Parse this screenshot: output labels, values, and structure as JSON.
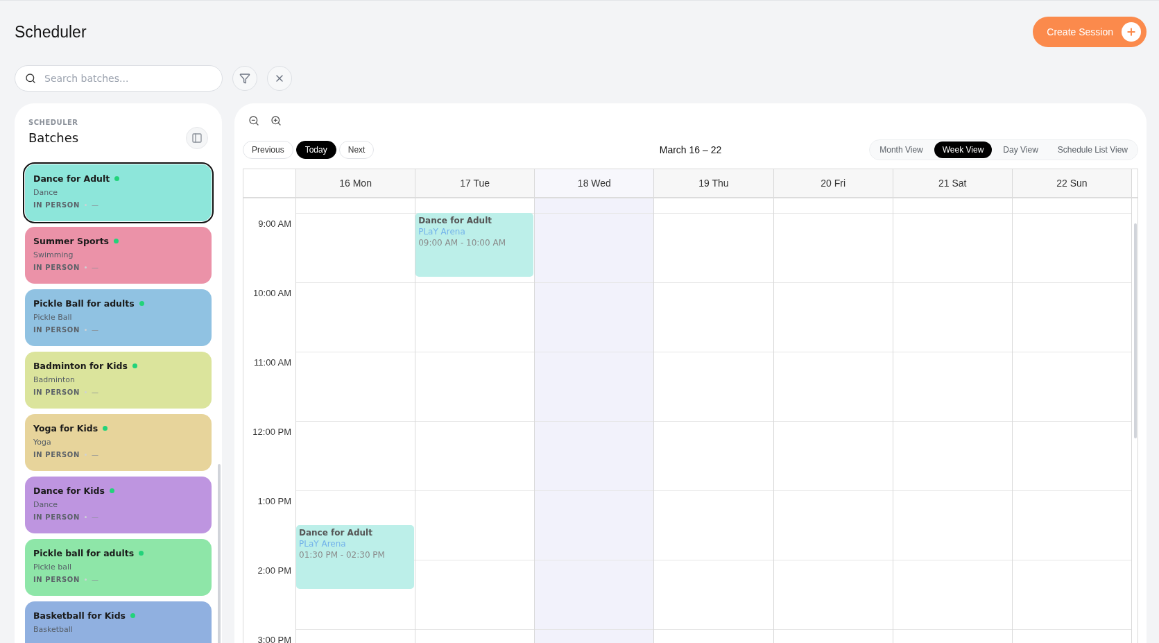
{
  "page": {
    "title": "Scheduler",
    "create_button": "Create Session"
  },
  "search": {
    "placeholder": "Search batches..."
  },
  "sidebar": {
    "eyebrow": "SCHEDULER",
    "title": "Batches",
    "batches": [
      {
        "name": "Dance for Adult",
        "sport": "Dance",
        "mode": "IN PERSON",
        "trainer": "—",
        "color": "#8de6da",
        "selected": true
      },
      {
        "name": "Summer Sports",
        "sport": "Swimming",
        "mode": "IN PERSON",
        "trainer": "—",
        "color": "#eb92a8",
        "selected": false
      },
      {
        "name": "Pickle Ball for adults",
        "sport": "Pickle Ball",
        "mode": "IN PERSON",
        "trainer": "—",
        "color": "#90c2e2",
        "selected": false
      },
      {
        "name": "Badminton for Kids",
        "sport": "Badminton",
        "mode": "IN PERSON",
        "trainer": "—",
        "color": "#dbe49c",
        "selected": false
      },
      {
        "name": "Yoga for Kids",
        "sport": "Yoga",
        "mode": "IN PERSON",
        "trainer": "—",
        "color": "#e7d49b",
        "selected": false
      },
      {
        "name": "Dance for Kids",
        "sport": "Dance",
        "mode": "IN PERSON",
        "trainer": "—",
        "color": "#be95e0",
        "selected": false
      },
      {
        "name": "Pickle ball for adults",
        "sport": "Pickle ball",
        "mode": "IN PERSON",
        "trainer": "—",
        "color": "#8ee6a8",
        "selected": false
      },
      {
        "name": "Basketball for Kids",
        "sport": "Basketball",
        "color": "#90b0e0",
        "selected": false
      }
    ]
  },
  "calendar": {
    "nav": [
      {
        "label": "Previous",
        "selected": false
      },
      {
        "label": "Today",
        "selected": true
      },
      {
        "label": "Next",
        "selected": false
      }
    ],
    "range": "March 16 – 22",
    "views": [
      {
        "label": "Month View",
        "selected": false
      },
      {
        "label": "Week View",
        "selected": true
      },
      {
        "label": "Day View",
        "selected": false
      },
      {
        "label": "Schedule List View",
        "selected": false
      }
    ],
    "hours": [
      "9:00 AM",
      "10:00 AM",
      "11:00 AM",
      "12:00 PM",
      "1:00 PM",
      "2:00 PM",
      "3:00 PM"
    ],
    "days": [
      {
        "label": "16 Mon",
        "today": false,
        "events": [
          {
            "title": "Dance for Adult",
            "place": "PLaY Arena",
            "time": "01:30 PM - 02:30 PM"
          }
        ]
      },
      {
        "label": "17 Tue",
        "today": false,
        "events": [
          {
            "title": "Dance for Adult",
            "place": "PLaY Arena",
            "time": "09:00 AM - 10:00 AM"
          }
        ]
      },
      {
        "label": "18 Wed",
        "today": true
      },
      {
        "label": "19 Thu",
        "today": false
      },
      {
        "label": "20 Fri",
        "today": false
      },
      {
        "label": "21 Sat",
        "today": false
      },
      {
        "label": "22 Sun",
        "today": false
      }
    ]
  }
}
